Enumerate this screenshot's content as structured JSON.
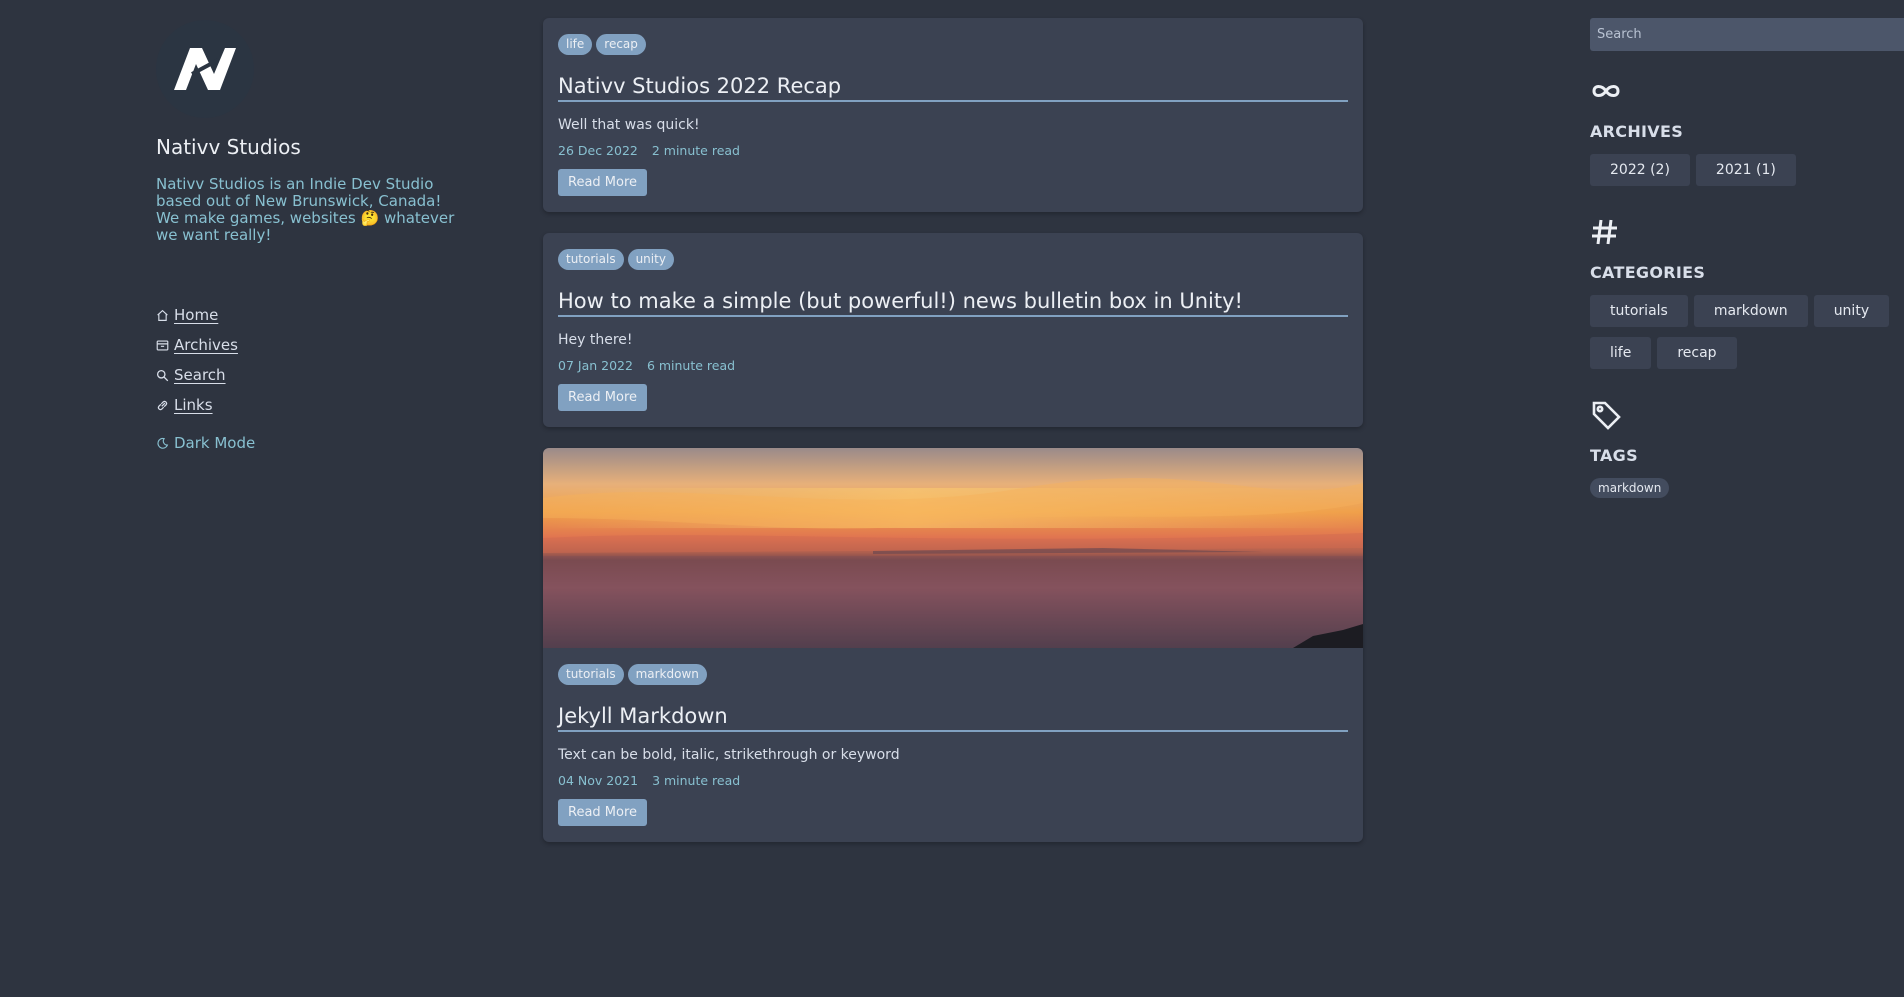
{
  "site": {
    "title": "Nativv Studios",
    "description_line1": "Nativv Studios is an Indie Dev Studio based out of New Brunswick, Canada!",
    "description_line2": "We make games, websites 🤔 whatever we want really!"
  },
  "nav": {
    "items": [
      {
        "label": "Home",
        "icon": "home-icon"
      },
      {
        "label": "Archives",
        "icon": "archive-icon"
      },
      {
        "label": "Search",
        "icon": "search-icon"
      },
      {
        "label": "Links",
        "icon": "link-icon"
      }
    ],
    "dark_mode": {
      "label": "Dark Mode",
      "icon": "moon-icon"
    }
  },
  "posts": [
    {
      "tags": [
        "life",
        "recap"
      ],
      "title": "Nativv Studios 2022 Recap",
      "excerpt": "Well that was quick!",
      "date": "26 Dec 2022",
      "read_time": "2 minute read",
      "button": "Read More"
    },
    {
      "tags": [
        "tutorials",
        "unity"
      ],
      "title": "How to make a simple (but powerful!) news bulletin box in Unity!",
      "excerpt": "Hey there!",
      "date": "07 Jan 2022",
      "read_time": "6 minute read",
      "button": "Read More"
    },
    {
      "tags": [
        "tutorials",
        "markdown"
      ],
      "title": "Jekyll Markdown",
      "excerpt": "Text can be bold, italic, strikethrough or keyword",
      "date": "04 Nov 2021",
      "read_time": "3 minute read",
      "button": "Read More",
      "image": "sunset-over-ocean"
    }
  ],
  "right": {
    "search_placeholder": "Search",
    "archives": {
      "title": "ARCHIVES",
      "icon": "infinity-icon",
      "items": [
        "2022 (2)",
        "2021 (1)"
      ]
    },
    "categories": {
      "title": "CATEGORIES",
      "icon": "hash-icon",
      "items": [
        "tutorials",
        "markdown",
        "unity",
        "life",
        "recap"
      ]
    },
    "tags": {
      "title": "TAGS",
      "icon": "tag-icon",
      "items": [
        "markdown"
      ]
    }
  },
  "colors": {
    "background": "#2e3440",
    "card": "#3b4252",
    "accent": "#81a1c1",
    "link": "#88c0d0"
  }
}
